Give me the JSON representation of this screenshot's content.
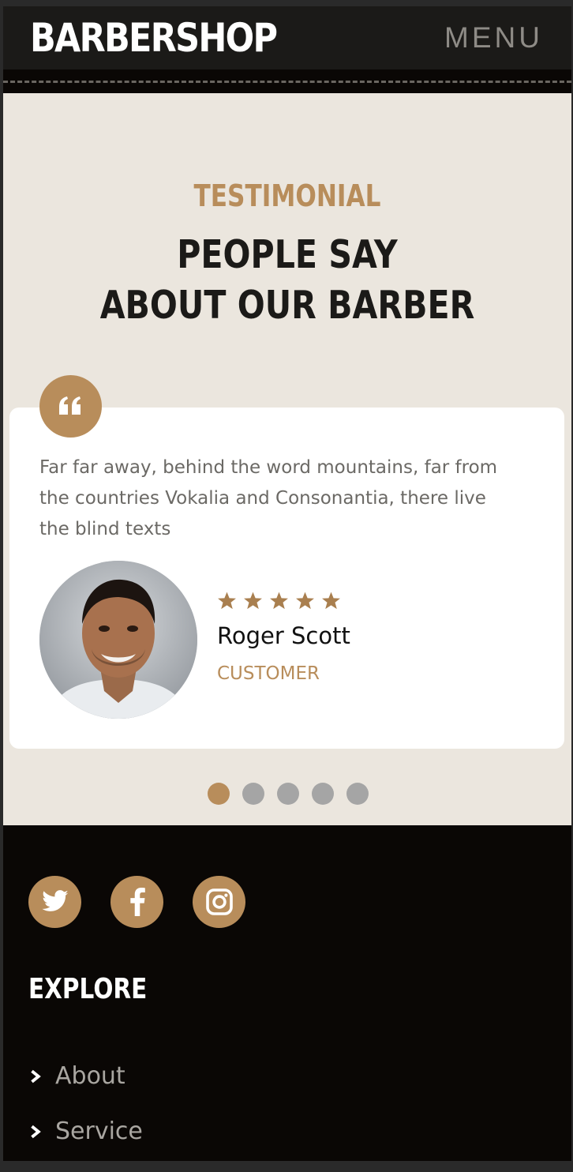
{
  "header": {
    "brand": "BARBERSHOP",
    "menu_label": "MENU"
  },
  "testimonial": {
    "eyebrow": "TESTIMONIAL",
    "heading_line1": "PEOPLE SAY",
    "heading_line2": "ABOUT OUR BARBER",
    "quote_icon": "quote-left-icon",
    "quote": "Far far away, behind the word mountains, far from the countries Vokalia and Consonantia, there live the blind texts",
    "rating": 5,
    "rating_max": 5,
    "author_name": "Roger Scott",
    "author_role": "CUSTOMER",
    "carousel": {
      "total": 5,
      "active": 1
    }
  },
  "footer": {
    "social": [
      {
        "name": "twitter",
        "icon": "twitter-icon"
      },
      {
        "name": "facebook",
        "icon": "facebook-icon"
      },
      {
        "name": "instagram",
        "icon": "instagram-icon"
      }
    ],
    "explore_title": "EXPLORE",
    "links": [
      {
        "label": "About",
        "icon": "chevron-right-icon"
      },
      {
        "label": "Service",
        "icon": "chevron-right-icon"
      }
    ]
  },
  "colors": {
    "accent": "#b88d5b",
    "dark": "#1b1a18",
    "section_bg": "#ebe6de",
    "footer_bg": "#0a0705"
  }
}
